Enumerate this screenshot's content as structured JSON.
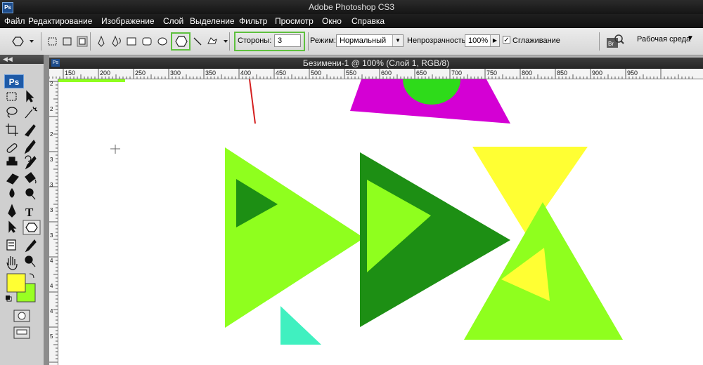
{
  "window": {
    "title": "Adobe Photoshop CS3",
    "app_badge": "Ps"
  },
  "menu": [
    "Файл",
    "Редактирование",
    "Изображение",
    "Слой",
    "Выделение",
    "Фильтр",
    "Просмотр",
    "Окно",
    "Справка"
  ],
  "options_bar": {
    "sides_label": "Стороны:",
    "sides_value": "3",
    "mode_label": "Режим:",
    "mode_value": "Нормальный",
    "opacity_label": "Непрозрачность",
    "opacity_value": "100%",
    "antialias_label": "Сглаживание",
    "antialias_checked": true,
    "workspace_label": "Рабочая среда"
  },
  "tools_panel": {
    "collapse_glyph": "◀◀",
    "logo": "Ps",
    "foreground_color": "#ffff33",
    "background_color": "#99ff22"
  },
  "document": {
    "tab_title": "Безимени-1 @ 100% (Слой 1, RGB/8)",
    "ruler_top_labels": [
      "150",
      "200",
      "250",
      "300",
      "350",
      "400",
      "450",
      "500",
      "550",
      "600",
      "650",
      "700",
      "750",
      "800",
      "850",
      "900",
      "950"
    ],
    "ruler_left_labels": [
      "2",
      "2",
      "2",
      "3",
      "3",
      "3",
      "3",
      "4",
      "4",
      "4",
      "5"
    ]
  },
  "canvas_colors": {
    "lime": "#8fff1e",
    "dark_green": "#1d8f14",
    "yellow": "#ffff33",
    "magenta": "#d400d4",
    "green_circle": "#2edb1a",
    "aqua": "#40f0c0",
    "red_line": "#d42020"
  }
}
